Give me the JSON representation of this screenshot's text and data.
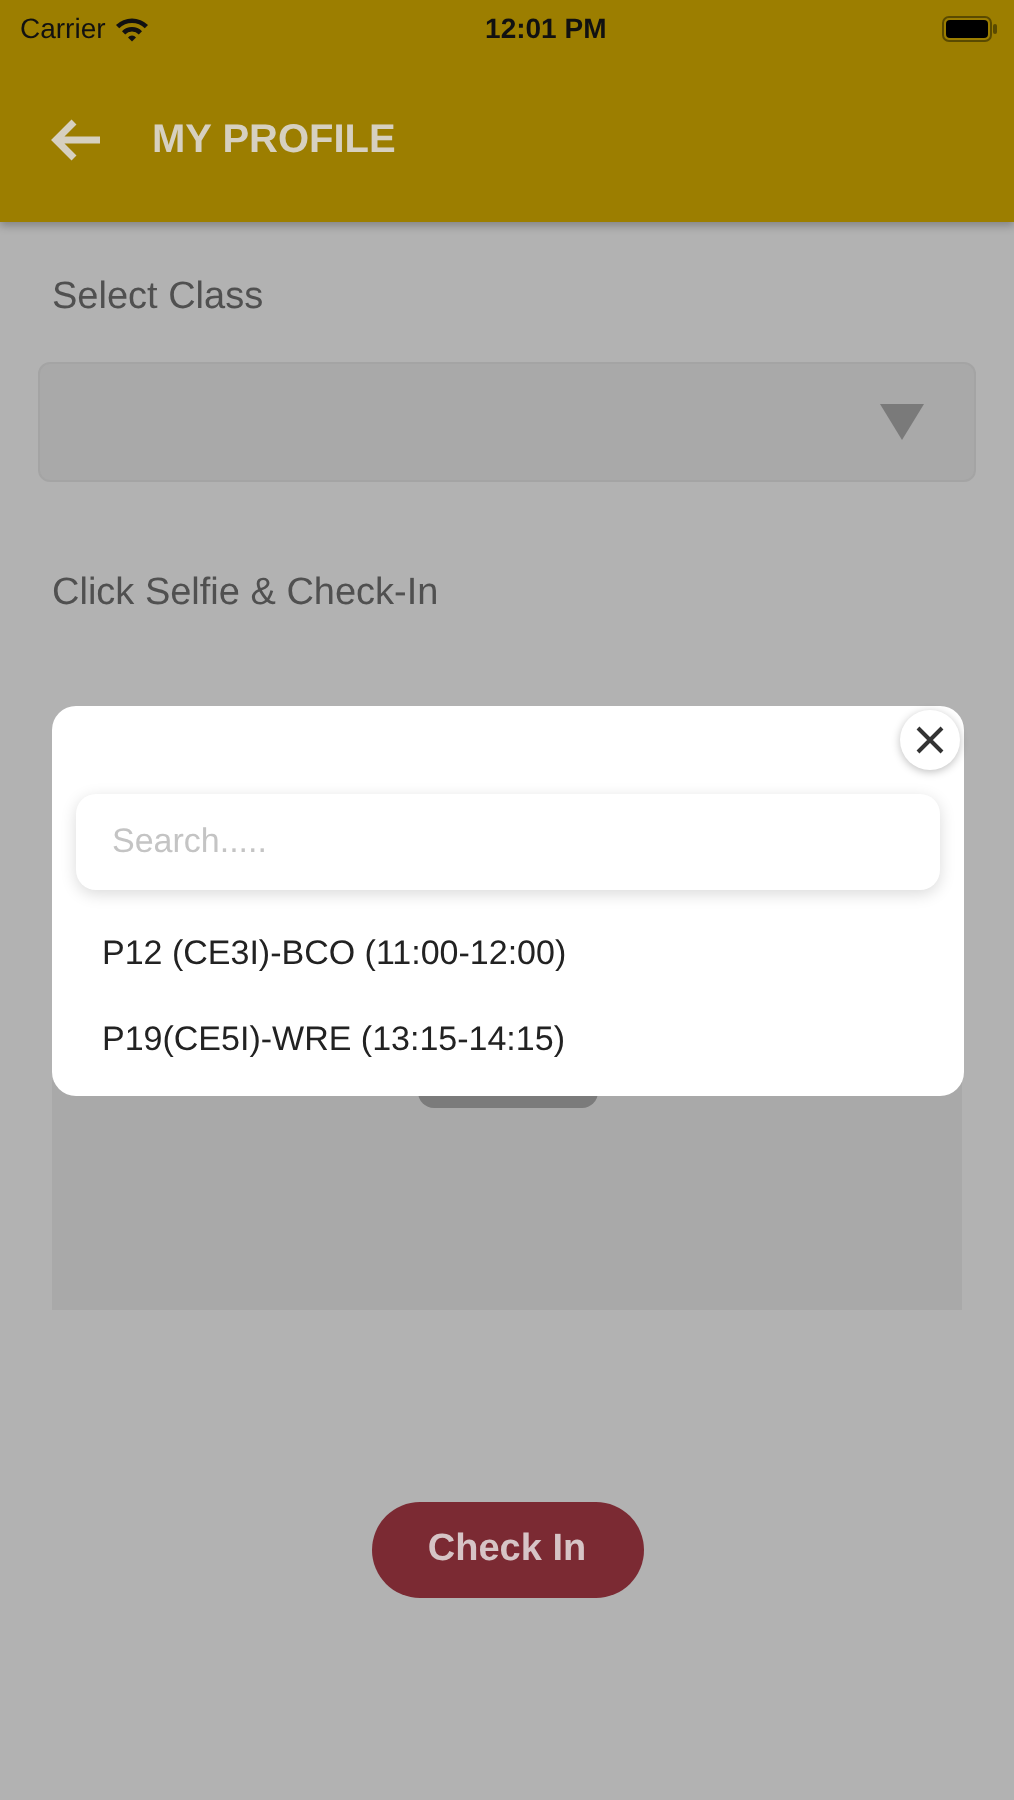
{
  "status_bar": {
    "carrier": "Carrier",
    "time": "12:01 PM"
  },
  "header": {
    "title": "MY PROFILE"
  },
  "form": {
    "class_label": "Select Class",
    "selfie_label": "Click Selfie & Check-In",
    "check_in_button": "Check In"
  },
  "class_picker": {
    "search": {
      "placeholder": "Search....."
    },
    "options": [
      {
        "label": "P12 (CE3I)-BCO (11:00-12:00)"
      },
      {
        "label": "P19(CE5I)-WRE (13:15-14:15)"
      }
    ]
  }
}
